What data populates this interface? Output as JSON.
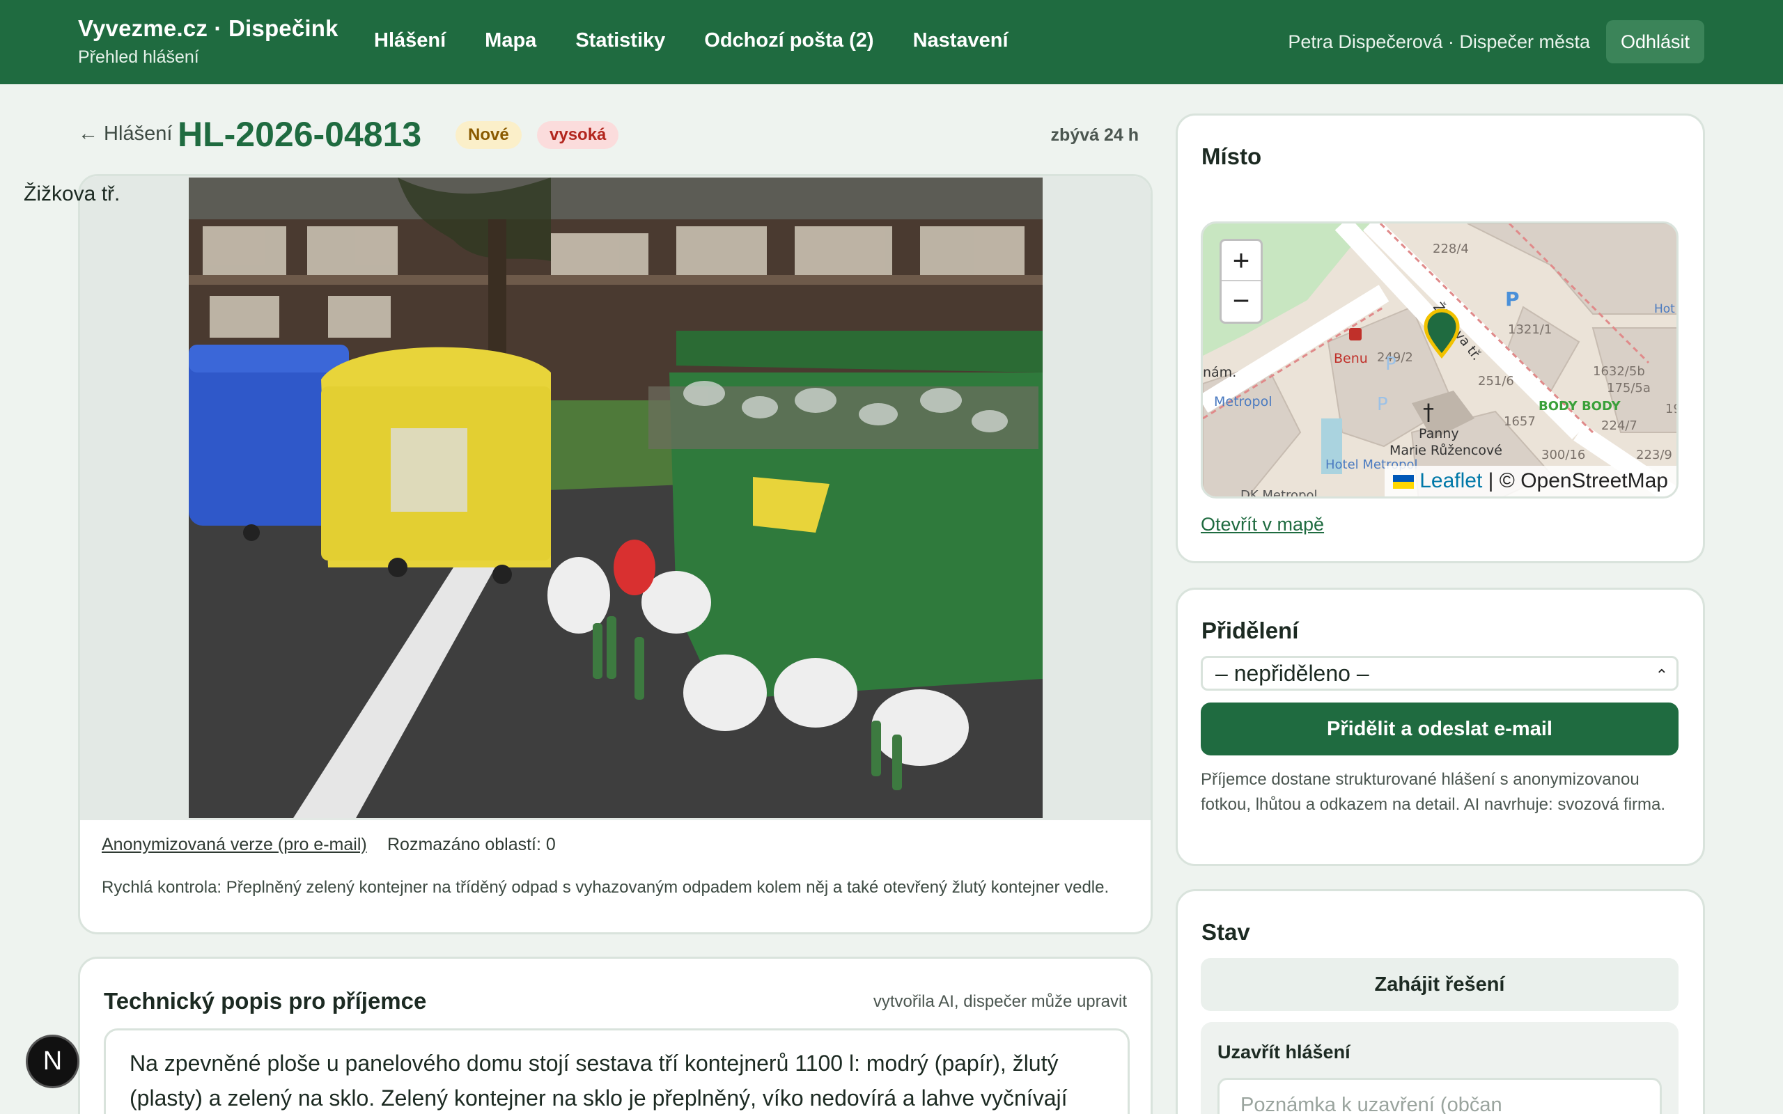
{
  "app": {
    "brand_title": "Vyvezme.cz · Dispečink",
    "brand_subtitle": "Přehled hlášení",
    "nav": [
      "Hlášení",
      "Mapa",
      "Statistiky",
      "Odchozí pošta (2)",
      "Nastavení"
    ],
    "user": "Petra Dispečerová · Dispečer města",
    "logout_label": "Odhlásit"
  },
  "report": {
    "back_label": "← Hlášení",
    "id": "HL-2026-04813",
    "status_badge": "Nové",
    "priority_badge": "vysoká",
    "deadline": "zbývá 24 h",
    "anonymized_link": "Anonymizovaná verze (pro e-mail)",
    "blurred_regions": "Rozmazáno oblastí: 0",
    "quick_check": "Rychlá kontrola: Přeplněný zelený kontejner na tříděný odpad s vyhazovaným odpadem kolem něj a také otevřený žlutý kontejner vedle."
  },
  "tech": {
    "title": "Technický popis pro příjemce",
    "note": "vytvořila AI, dispečer může upravit",
    "text": "Na zpevněné ploše u panelového domu stojí sestava tří kontejnerů 1100 l: modrý (papír), žlutý (plasty) a zelený na sklo. Zelený kontejner na sklo je přeplněný, víko nedovírá a lahve vyčnívají"
  },
  "place": {
    "title": "Místo",
    "street": "Žižkova tř.",
    "open_map": "Otevřít v mapě",
    "map_zoom_in": "+",
    "map_zoom_out": "−",
    "map_labels": {
      "street": "Žižkova tř.",
      "pharmacy": "Benu",
      "church_1": "Panny",
      "church_2": "Marie Růžencové",
      "fitness": "BODY BODY",
      "metropol": "Metropol",
      "hotel": "Hotel Metropol",
      "dk": "DK Metropol",
      "nam": "nám.",
      "hot": "Hot",
      "n1": "228/4",
      "n2": "1321/1",
      "n3": "249/2",
      "n4": "251/6",
      "n5": "1632/5b",
      "n6": "175/5a",
      "n7": "1657",
      "n8": "224/7",
      "n9": "300/16",
      "n10": "223/9",
      "n11": "19"
    },
    "attribution_leaflet": "Leaflet",
    "attribution_osm": "| © OpenStreetMap"
  },
  "assign": {
    "title": "Přidělení",
    "select_value": "– nepřiděleno –",
    "button": "Přidělit a odeslat e-mail",
    "help": "Příjemce dostane strukturované hlášení s anonymizovanou fotkou, lhůtou a odkazem na detail. AI navrhuje: svozová firma."
  },
  "state": {
    "title": "Stav",
    "start_button": "Zahájit řešení",
    "close_title": "Uzavřít hlášení",
    "close_placeholder": "Poznámka k uzavření (občan"
  },
  "dev_badge": "N",
  "colors": {
    "brand_green": "#1f6b40",
    "background": "#eef3ef",
    "badge_new_bg": "#fbefc9",
    "badge_priority_bg": "#fbdcdc",
    "container_blue": "#2f58c9",
    "container_yellow": "#e8d43a",
    "container_green": "#2f7a3c"
  }
}
